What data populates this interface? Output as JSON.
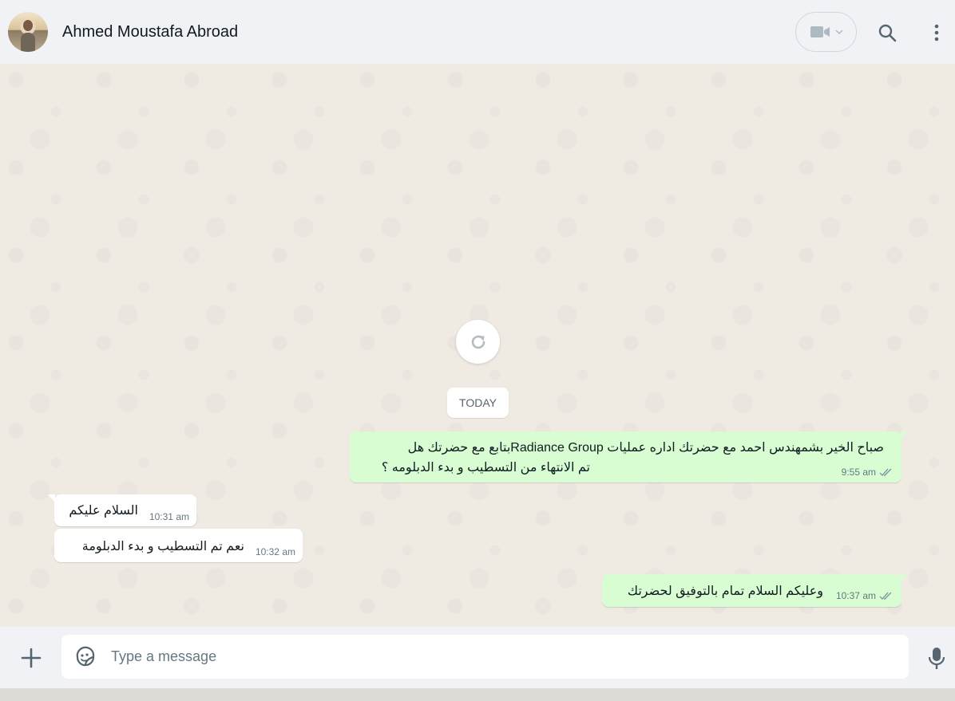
{
  "header": {
    "contact_name": "Ahmed Moustafa Abroad",
    "icons": {
      "avatar": "contact-avatar",
      "video": "video-camera-icon",
      "video_dropdown": "chevron-down-icon",
      "search": "search-icon",
      "menu": "vertical-dots-icon"
    }
  },
  "chat": {
    "refresh_icon": "refresh-icon",
    "date_divider": "TODAY",
    "messages": [
      {
        "direction": "outgoing",
        "line1": "صباح الخير بشمهندس احمد مع  حضرتك اداره عمليات Radiance Groupبتابع مع حضرتك هل",
        "line2": "تم الانتهاء من التسطيب و بدء الدبلومه ؟",
        "time": "9:55 am",
        "status_icon": "double-check-icon"
      },
      {
        "direction": "incoming",
        "text": "السلام عليكم",
        "time": "10:31 am"
      },
      {
        "direction": "incoming",
        "text": "نعم تم التسطيب و بدء الدبلومة",
        "time": "10:32 am"
      },
      {
        "direction": "outgoing",
        "text": "وعليكم السلام تمام بالتوفيق لحضرتك",
        "time": "10:37 am",
        "status_icon": "double-check-icon"
      }
    ]
  },
  "composer": {
    "placeholder": "Type a message",
    "value": "",
    "icons": {
      "attach": "plus-icon",
      "sticker": "sticker-icon",
      "mic": "microphone-icon"
    }
  },
  "colors": {
    "header_bg": "#f0f2f5",
    "chat_bg": "#efeae2",
    "outgoing_bubble": "#d9fdd3",
    "incoming_bubble": "#ffffff",
    "meta_text": "#667781"
  }
}
